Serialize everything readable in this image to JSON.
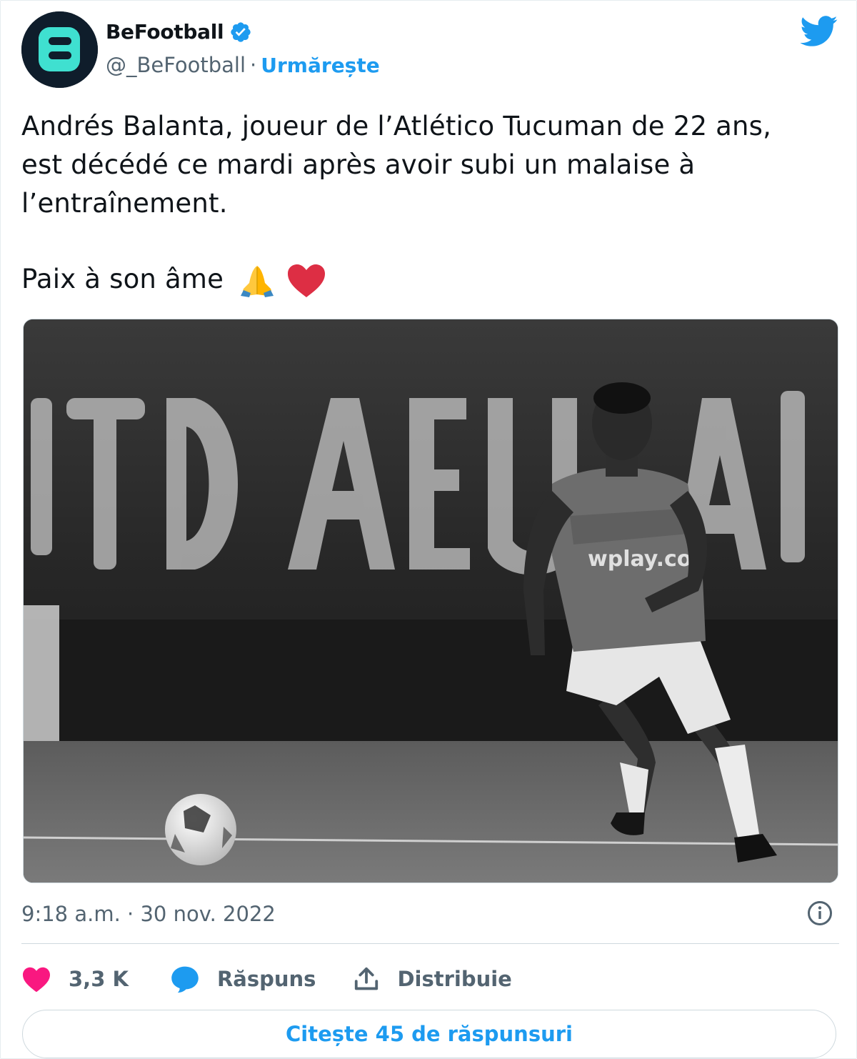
{
  "author": {
    "name": "BeFootball",
    "handle": "@_BeFootball",
    "separator": "·",
    "follow_label": "Urmărește",
    "verified_icon": "verified-badge-icon",
    "avatar_icon": "befootball-logo"
  },
  "tweet": {
    "lines": [
      "Andrés Balanta, joueur de l’Atlético Tucuman de 22 ans,",
      "est décédé ce mardi après avoir subi un malaise à",
      "l’entraînement."
    ],
    "closing": "Paix à son âme",
    "emojis": [
      "folded-hands-icon",
      "red-heart-icon"
    ]
  },
  "media": {
    "jersey_sponsor": "wplay.co",
    "banner_letters": "ITO AEU LA"
  },
  "meta": {
    "timestamp": "9:18 a.m. · 30 nov. 2022"
  },
  "actions": {
    "like_count": "3,3 K",
    "reply_label": "Răspuns",
    "share_label": "Distribuie"
  },
  "cta": {
    "label": "Citește 45 de răspunsuri"
  },
  "colors": {
    "accent": "#1d9bf0",
    "like": "#f91880",
    "text": "#0f1419",
    "secondary": "#536471",
    "avatar_bg": "#0f1d2b",
    "logo": "#3fe0d0"
  }
}
